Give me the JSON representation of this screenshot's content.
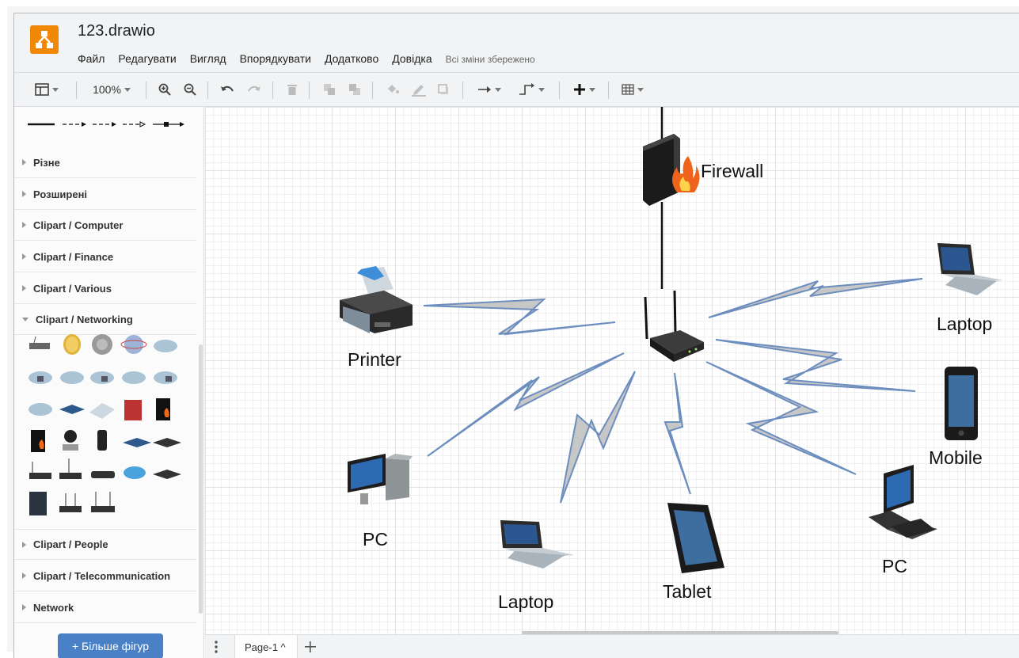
{
  "app": {
    "file_name": "123.drawio",
    "save_status": "Всі зміни збережено",
    "menu": [
      "Файл",
      "Редагувати",
      "Вигляд",
      "Впорядкувати",
      "Додатково",
      "Довідка"
    ]
  },
  "toolbar": {
    "zoom": "100%"
  },
  "sidebar": {
    "categories_top": [
      "Різне",
      "Розширені",
      "Clipart / Computer",
      "Clipart / Finance",
      "Clipart / Various"
    ],
    "open_category": "Clipart / Networking",
    "categories_bottom": [
      "Clipart / People",
      "Clipart / Telecommunication",
      "Network"
    ],
    "more_shapes": "+ Більше фігур"
  },
  "diagram": {
    "labels": {
      "firewall": "Firewall",
      "printer": "Printer",
      "laptop_right": "Laptop",
      "mobile": "Mobile",
      "pc_left": "PC",
      "laptop_bottom": "Laptop",
      "tablet": "Tablet",
      "pc_right": "PC"
    }
  },
  "pages": {
    "current": "Page-1 ^"
  },
  "colors": {
    "logo": "#f08705",
    "link_fill": "#c7c7c7",
    "link_stroke": "#6c8ebf",
    "more_button": "#4a80c6"
  }
}
